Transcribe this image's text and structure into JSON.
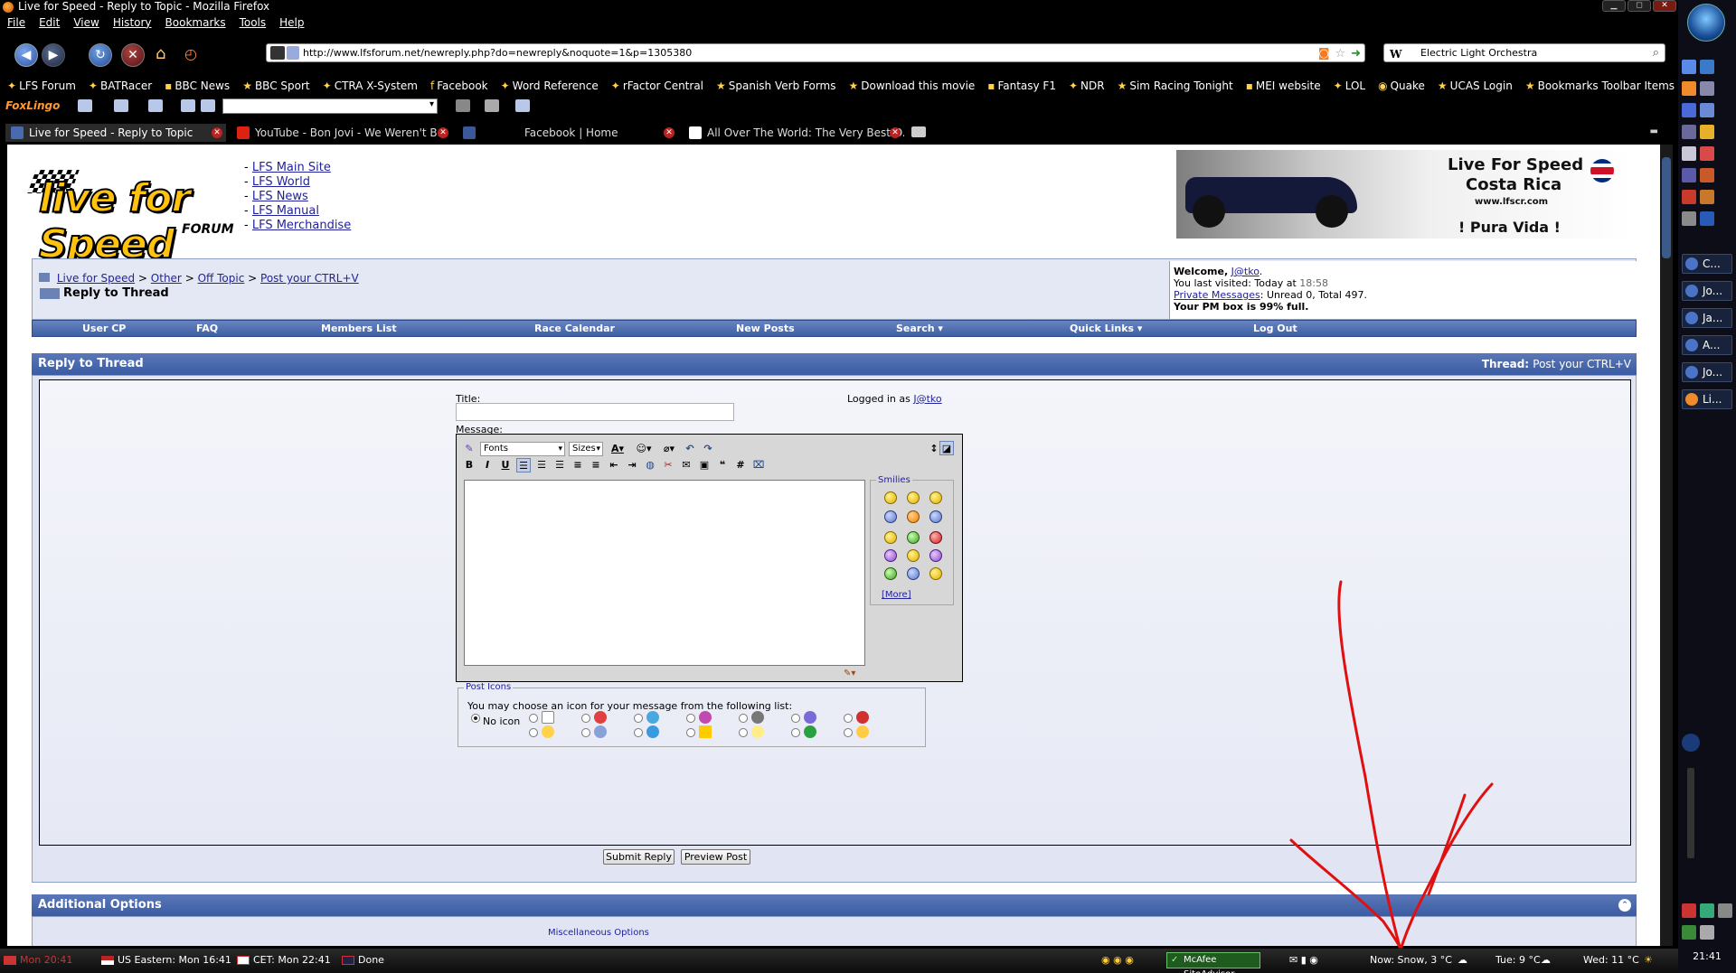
{
  "window": {
    "title": "Live for Speed - Reply to Topic - Mozilla Firefox",
    "controls": [
      "▁",
      "◻",
      "✕"
    ]
  },
  "menu": [
    "File",
    "Edit",
    "View",
    "History",
    "Bookmarks",
    "Tools",
    "Help"
  ],
  "navbar": {
    "url": "http://www.lfsforum.net/newreply.php?do=newreply&noquote=1&p=1305380",
    "search_value": "Electric Light Orchestra",
    "search_engine_glyph": "W"
  },
  "bookmarks": [
    "LFS Forum",
    "BATRacer",
    "BBC News",
    "BBC Sport",
    "CTRA X-System",
    "Facebook",
    "Word Reference",
    "rFactor Central",
    "Spanish Verb Forms",
    "Download this movie",
    "Fantasy F1",
    "NDR",
    "Sim Racing Tonight",
    "MEI website",
    "LOL",
    "Quake",
    "UCAS Login",
    "Bookmarks Toolbar Items"
  ],
  "foxlingo_label": "FoxLingo",
  "tabs": [
    {
      "title": "Live for Speed - Reply to Topic",
      "active": true
    },
    {
      "title": "YouTube - Bon Jovi - We Weren't B...",
      "active": false
    },
    {
      "title": "Facebook | Home",
      "active": false
    },
    {
      "title": "All Over The World: The Very Best O...",
      "active": false
    }
  ],
  "header": {
    "logo_text": "live for Speed",
    "logo_sub": "FORUM",
    "links": [
      "LFS Main Site",
      "LFS World",
      "LFS News",
      "LFS Manual",
      "LFS Merchandise"
    ],
    "banner": {
      "line1": "Live For Speed",
      "line2": "Costa Rica",
      "line3": "www.lfscr.com",
      "line4": "! Pura Vida !"
    }
  },
  "breadcrumb": {
    "items": [
      "Live for Speed",
      "Other",
      "Off Topic",
      "Post your CTRL+V"
    ],
    "separator": ">",
    "current": "Reply to Thread"
  },
  "welcome": {
    "label": "Welcome,",
    "user": "J@tko",
    "last_visited_label": "You last visited: Today at",
    "last_visited_time": "18:58",
    "pm_link": "Private Messages",
    "pm_stats": ": Unread 0, Total 497.",
    "pm_full": "Your PM box is 99% full."
  },
  "nav": [
    "User CP",
    "FAQ",
    "Members List",
    "Race Calendar",
    "New Posts",
    "Search ▾",
    "Quick Links ▾",
    "Log Out"
  ],
  "reply": {
    "heading": "Reply to Thread",
    "thread_label": "Thread:",
    "thread_name": "Post your CTRL+V",
    "title_label": "Title:",
    "title_value": "",
    "logged_in_label": "Logged in as",
    "logged_in_user": "J@tko",
    "message_label": "Message:",
    "toolbar": {
      "fonts": "Fonts",
      "sizes": "Sizes",
      "bold": "B",
      "italic": "I",
      "underline": "U",
      "hash": "#"
    },
    "smilies_legend": "Smilies",
    "more_link": "[More]",
    "post_icons_legend": "Post Icons",
    "post_icons_desc": "You may choose an icon for your message from the following list:",
    "no_icon_label": "No icon",
    "submit": "Submit Reply",
    "preview": "Preview Post"
  },
  "additional": {
    "heading": "Additional Options",
    "misc_legend": "Miscellaneous Options"
  },
  "taskbar": {
    "clock_label": "Mon 20:41",
    "us_eastern": "US Eastern: Mon 16:41",
    "cet": "CET: Mon 22:41",
    "status": "Done",
    "mcafee": "McAfee SiteAdvisor",
    "weather_now": "Now: Snow, 3 °C",
    "weather_tue": "Tue: 9 °C",
    "weather_wed": "Wed: 11 °C"
  },
  "sidebar": {
    "tasks": [
      "C...",
      "Jo...",
      "Ja...",
      "A...",
      "Jo...",
      "Li..."
    ],
    "clock": "21:41"
  },
  "colors": {
    "link": "#22229c",
    "header_blue": "#3b5ca3",
    "annotation": "#e01010"
  }
}
